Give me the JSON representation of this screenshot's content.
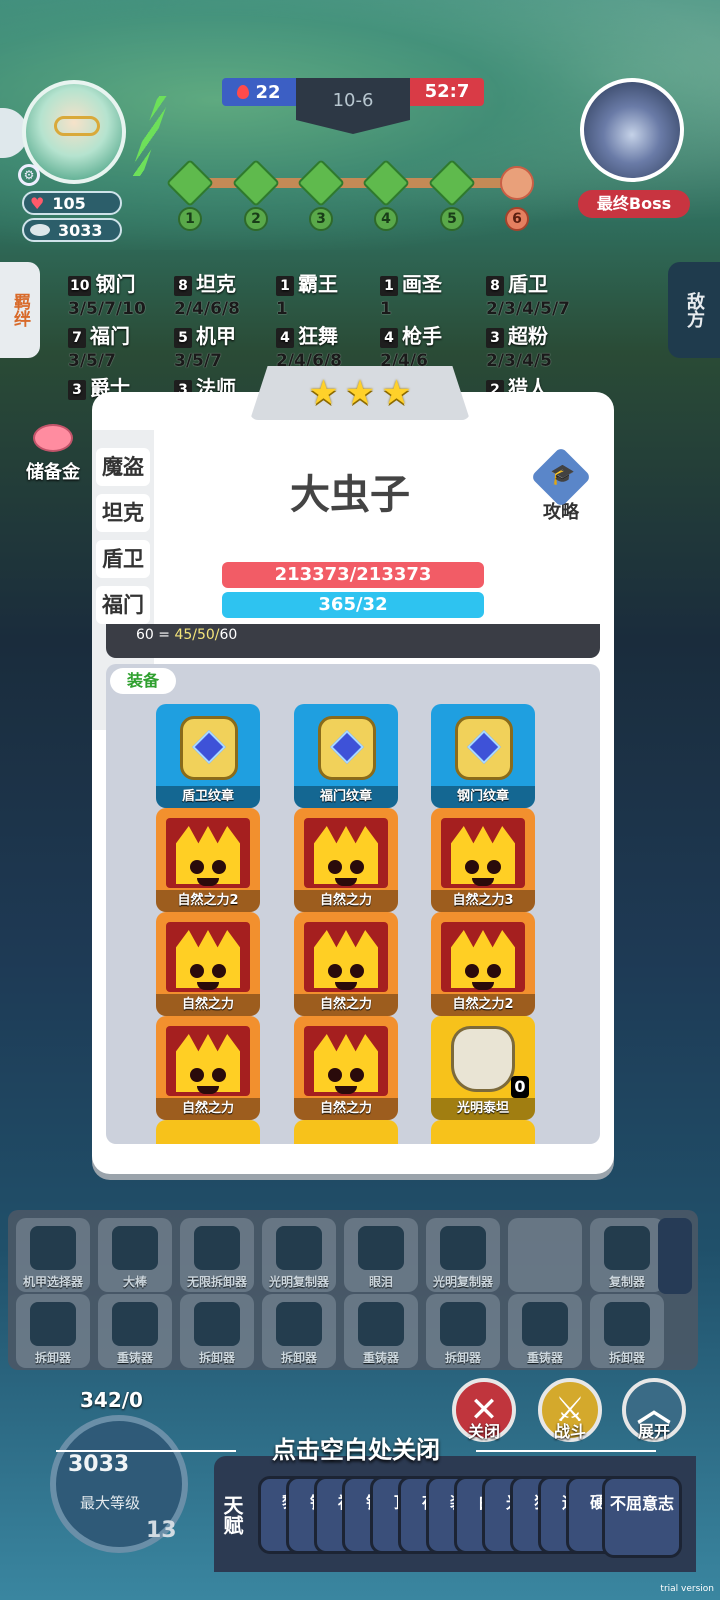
{
  "hud": {
    "hp": "105",
    "gold": "3033",
    "left_score": "22",
    "round": "10-6",
    "timer": "52:7",
    "stages": [
      "1",
      "2",
      "3",
      "4",
      "5",
      "6"
    ],
    "boss_label": "最终Boss"
  },
  "side_tabs": {
    "left": "羁绊",
    "right": "敌方"
  },
  "traits": [
    {
      "count": "10",
      "name": "钢门",
      "levels": "3/5/7/10"
    },
    {
      "count": "8",
      "name": "坦克",
      "levels": "2/4/6/8"
    },
    {
      "count": "1",
      "name": "霸王",
      "levels": "1"
    },
    {
      "count": "1",
      "name": "画圣",
      "levels": "1"
    },
    {
      "count": "8",
      "name": "盾卫",
      "levels": "2/3/4/5/7"
    },
    {
      "count": "7",
      "name": "福门",
      "levels": "3/5/7"
    },
    {
      "count": "5",
      "name": "机甲",
      "levels": "3/5/7"
    },
    {
      "count": "4",
      "name": "狂舞",
      "levels": "2/4/6/8"
    },
    {
      "count": "4",
      "name": "枪手",
      "levels": "2/4/6"
    },
    {
      "count": "3",
      "name": "超粉",
      "levels": "2/3/4/5"
    },
    {
      "count": "3",
      "name": "爵士",
      "levels": ""
    },
    {
      "count": "3",
      "name": "法师",
      "levels": ""
    },
    {
      "count": "2",
      "name": "猎人",
      "levels": ""
    }
  ],
  "piggy_label": "储备金",
  "modal": {
    "star_count": 3,
    "stars": [
      "★",
      "★",
      "★"
    ],
    "unit_name": "大虫子",
    "strategy_label": "攻略",
    "hp_text": "213373/213373",
    "mp_text": "365/32",
    "stat_line_prefix": "60 = ",
    "stat_line_values": "45/50/",
    "stat_line_suffix": "60",
    "sidebar_tabs": [
      "魔盗",
      "坦克",
      "盾卫",
      "福门"
    ],
    "equip_tag": "装备",
    "items": [
      {
        "label": "盾卫纹章",
        "kind": "emblem"
      },
      {
        "label": "福门纹章",
        "kind": "emblem"
      },
      {
        "label": "钢门纹章",
        "kind": "emblem"
      },
      {
        "label": "自然之力2",
        "kind": "crown"
      },
      {
        "label": "自然之力",
        "kind": "crown"
      },
      {
        "label": "自然之力3",
        "kind": "crown"
      },
      {
        "label": "自然之力",
        "kind": "crown"
      },
      {
        "label": "自然之力",
        "kind": "crown"
      },
      {
        "label": "自然之力2",
        "kind": "crown"
      },
      {
        "label": "自然之力",
        "kind": "crown"
      },
      {
        "label": "自然之力",
        "kind": "crown"
      },
      {
        "label": "光明泰坦",
        "kind": "titan",
        "count": "0"
      }
    ]
  },
  "bench": {
    "row1": [
      "机甲选择器",
      "大棒",
      "无限拆卸器",
      "光明复制器",
      "眼泪",
      "光明复制器",
      "",
      "复制器"
    ],
    "row2": [
      "拆卸器",
      "重铸器",
      "拆卸器",
      "拆卸器",
      "重铸器",
      "拆卸器",
      "重铸器",
      "拆卸器"
    ]
  },
  "bottom": {
    "exp": "342/0",
    "gold": "3033",
    "max_level": "最大等级",
    "level": "13",
    "close_hint": "点击空白处关闭",
    "btn_close": "关闭",
    "btn_fight": "战斗",
    "btn_expand": "展开",
    "talent_label": "天赋",
    "talent_chips": [
      "黎",
      "钢",
      "福",
      "钢",
      "顶",
      "夜",
      "装",
      "白",
      "光",
      "狂",
      "运",
      "硬"
    ],
    "talent_last": "不屈意志"
  },
  "watermark": "trial version"
}
